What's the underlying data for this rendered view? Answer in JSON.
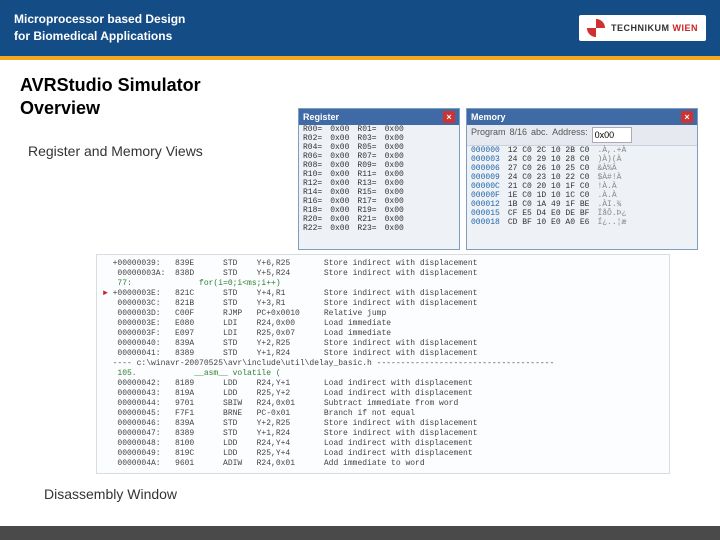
{
  "header": {
    "line1": "Microprocessor based Design",
    "line2": "for Biomedical Applications",
    "logo_main": "TECHNIKUM",
    "logo_sub": "WIEN"
  },
  "title_l1": "AVRStudio Simulator",
  "title_l2": "Overview",
  "section_reg": "Register and Memory Views",
  "section_dis": "Disassembly Window",
  "register": {
    "title": "Register",
    "rows": [
      [
        "R00=",
        "0x00",
        "R01=",
        "0x00"
      ],
      [
        "R02=",
        "0x00",
        "R03=",
        "0x00"
      ],
      [
        "R04=",
        "0x00",
        "R05=",
        "0x00"
      ],
      [
        "R06=",
        "0x00",
        "R07=",
        "0x00"
      ],
      [
        "R08=",
        "0x00",
        "R09=",
        "0x00"
      ],
      [
        "R10=",
        "0x00",
        "R11=",
        "0x00"
      ],
      [
        "R12=",
        "0x00",
        "R13=",
        "0x00"
      ],
      [
        "R14=",
        "0x00",
        "R15=",
        "0x00"
      ],
      [
        "R16=",
        "0x00",
        "R17=",
        "0x00"
      ],
      [
        "R18=",
        "0x00",
        "R19=",
        "0x00"
      ],
      [
        "R20=",
        "0x00",
        "R21=",
        "0x00"
      ],
      [
        "R22=",
        "0x00",
        "R23=",
        "0x00"
      ]
    ]
  },
  "memory": {
    "title": "Memory",
    "select": "Program",
    "span": "8/16",
    "ascii": "abc.",
    "addr_lbl": "Address:",
    "addr_val": "0x00",
    "rows": [
      [
        "000000",
        "12 C0 2C 10 2B C0",
        ".À,.+À"
      ],
      [
        "000003",
        "24 C0 29 10 28 C0",
        ")À)(À"
      ],
      [
        "000006",
        "27 C0 26 10 25 C0",
        "&À%À"
      ],
      [
        "000009",
        "24 C0 23 10 22 C0",
        "$À#!À"
      ],
      [
        "00000C",
        "21 C0 20 10 1F C0",
        "!À.À"
      ],
      [
        "00000F",
        "1E C0 1D 10 1C C0",
        ".À.À"
      ],
      [
        "000012",
        "1B C0 1A 49 1F BE",
        ".ÀI.¾"
      ],
      [
        "000015",
        "CF E5 D4 E0 DE BF",
        "ÏåÔ.Þ¿"
      ],
      [
        "000018",
        "CD BF 10 E0 A0 E6",
        "Í¿..¦æ"
      ]
    ]
  },
  "disasm": {
    "rows": [
      {
        "a": "+00000039:",
        "b": "839E",
        "c": "STD",
        "d": "Y+6,R25",
        "e": "Store indirect with displacement"
      },
      {
        "a": " 00000003A:",
        "b": "838D",
        "c": "STD",
        "d": "Y+5,R24",
        "e": "Store indirect with displacement"
      },
      {
        "a": " 77: ",
        "b": "     for(i=0;i<ms;i++)",
        "c": "",
        "d": "",
        "e": "",
        "green": true
      },
      {
        "a": "+0000003E:",
        "b": "821C",
        "c": "STD",
        "d": "Y+4,R1",
        "e": "Store indirect with displacement",
        "mark": true
      },
      {
        "a": " 0000003C:",
        "b": "821B",
        "c": "STD",
        "d": "Y+3,R1",
        "e": "Store indirect with displacement"
      },
      {
        "a": " 0000003D:",
        "b": "C00F",
        "c": "RJMP",
        "d": "PC+0x0010",
        "e": "Relative jump"
      },
      {
        "a": " 0000003E:",
        "b": "E080",
        "c": "LDI",
        "d": "R24,0x00",
        "e": "Load immediate"
      },
      {
        "a": " 0000003F:",
        "b": "E097",
        "c": "LDI",
        "d": "R25,0x07",
        "e": "Load immediate"
      },
      {
        "a": " 00000040:",
        "b": "839A",
        "c": "STD",
        "d": "Y+2,R25",
        "e": "Store indirect with displacement"
      },
      {
        "a": " 00000041:",
        "b": "8389",
        "c": "STD",
        "d": "Y+1,R24",
        "e": "Store indirect with displacement"
      },
      {
        "a": "---- c:\\winavr-20070525\\avr\\include\\util\\delay_basic.h -------------------------------------",
        "b": "",
        "c": "",
        "d": "",
        "e": ""
      },
      {
        "a": " 105. ",
        "b": "    __asm__ volatile (",
        "c": "",
        "d": "",
        "e": "",
        "green": true
      },
      {
        "a": " 00000042:",
        "b": "8189",
        "c": "LDD",
        "d": "R24,Y+1",
        "e": "Load indirect with displacement"
      },
      {
        "a": " 00000043:",
        "b": "819A",
        "c": "LDD",
        "d": "R25,Y+2",
        "e": "Load indirect with displacement"
      },
      {
        "a": " 00000044:",
        "b": "9701",
        "c": "SBIW",
        "d": "R24,0x01",
        "e": "Subtract immediate from word"
      },
      {
        "a": " 00000045:",
        "b": "F7F1",
        "c": "BRNE",
        "d": "PC-0x01",
        "e": "Branch if not equal"
      },
      {
        "a": " 00000046:",
        "b": "839A",
        "c": "STD",
        "d": "Y+2,R25",
        "e": "Store indirect with displacement"
      },
      {
        "a": " 00000047:",
        "b": "8389",
        "c": "STD",
        "d": "Y+1,R24",
        "e": "Store indirect with displacement"
      },
      {
        "a": " 00000048:",
        "b": "8100",
        "c": "LDD",
        "d": "R24,Y+4",
        "e": "Load indirect with displacement"
      },
      {
        "a": " 00000049:",
        "b": "819C",
        "c": "LDD",
        "d": "R25,Y+4",
        "e": "Load indirect with displacement"
      },
      {
        "a": " 0000004A:",
        "b": "9601",
        "c": "ADIW",
        "d": "R24,0x01",
        "e": "Add immediate to word"
      }
    ]
  }
}
